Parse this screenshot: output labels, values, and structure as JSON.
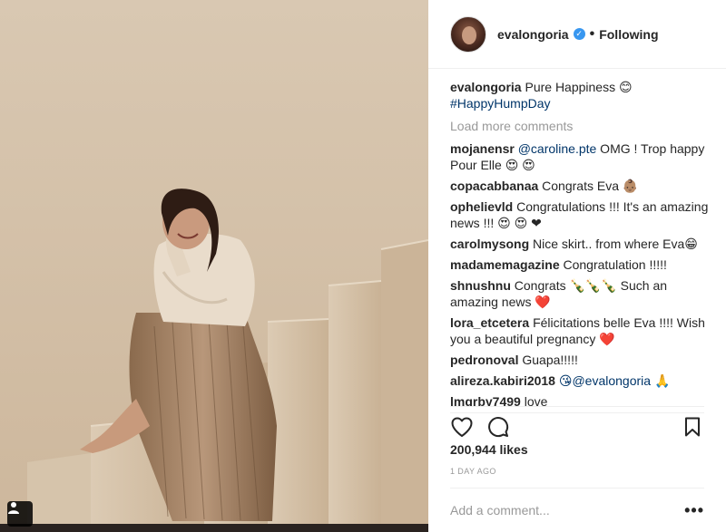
{
  "post": {
    "username": "evalongoria",
    "follow_status": "Following",
    "separator": "•",
    "caption_text": "Pure Happiness 😊",
    "caption_hashtag": "#HappyHumpDay",
    "load_more_label": "Load more comments",
    "likes": "200,944 likes",
    "timestamp": "1 DAY AGO",
    "comment_placeholder": "Add a comment...",
    "more_options": "•••"
  },
  "comments": [
    {
      "user": "mojanensr",
      "mention": "@caroline.pte",
      "text": " OMG ! Trop happy Pour Elle 😍 😍"
    },
    {
      "user": "copacabbanaa",
      "mention": "",
      "text": "Congrats Eva 👶🏽"
    },
    {
      "user": "ophelievld",
      "mention": "",
      "text": "Congratulations !!! It's an amazing news !!! 😍 😍 ❤"
    },
    {
      "user": "carolmysong",
      "mention": "",
      "text": "Nice skirt.. from where Eva😁"
    },
    {
      "user": "madamemagazine",
      "mention": "",
      "text": "Congratulation !!!!!"
    },
    {
      "user": "shnushnu",
      "mention": "",
      "text": "Congrats 🍾🍾🍾 Such an amazing news ❤️"
    },
    {
      "user": "lora_etcetera",
      "mention": "",
      "text": "Félicitations belle Eva !!!! Wish you a beautiful pregnancy ❤️"
    },
    {
      "user": "pedronoval",
      "mention": "",
      "text": "Guapa!!!!!"
    },
    {
      "user": "alireza.kabiri2018",
      "mention": "@evalongoria",
      "text": " 😘@evalongoria 🙏"
    },
    {
      "user": "lmgrby7499",
      "mention": "",
      "text": "love"
    }
  ],
  "icons": {
    "heart": "heart-icon",
    "comment": "comment-icon",
    "bookmark": "bookmark-icon",
    "tag": "user-tag-icon",
    "verified": "verified-badge-icon"
  },
  "colors": {
    "link": "#003569",
    "muted": "#999999",
    "verified": "#3897f0",
    "text": "#262626"
  }
}
